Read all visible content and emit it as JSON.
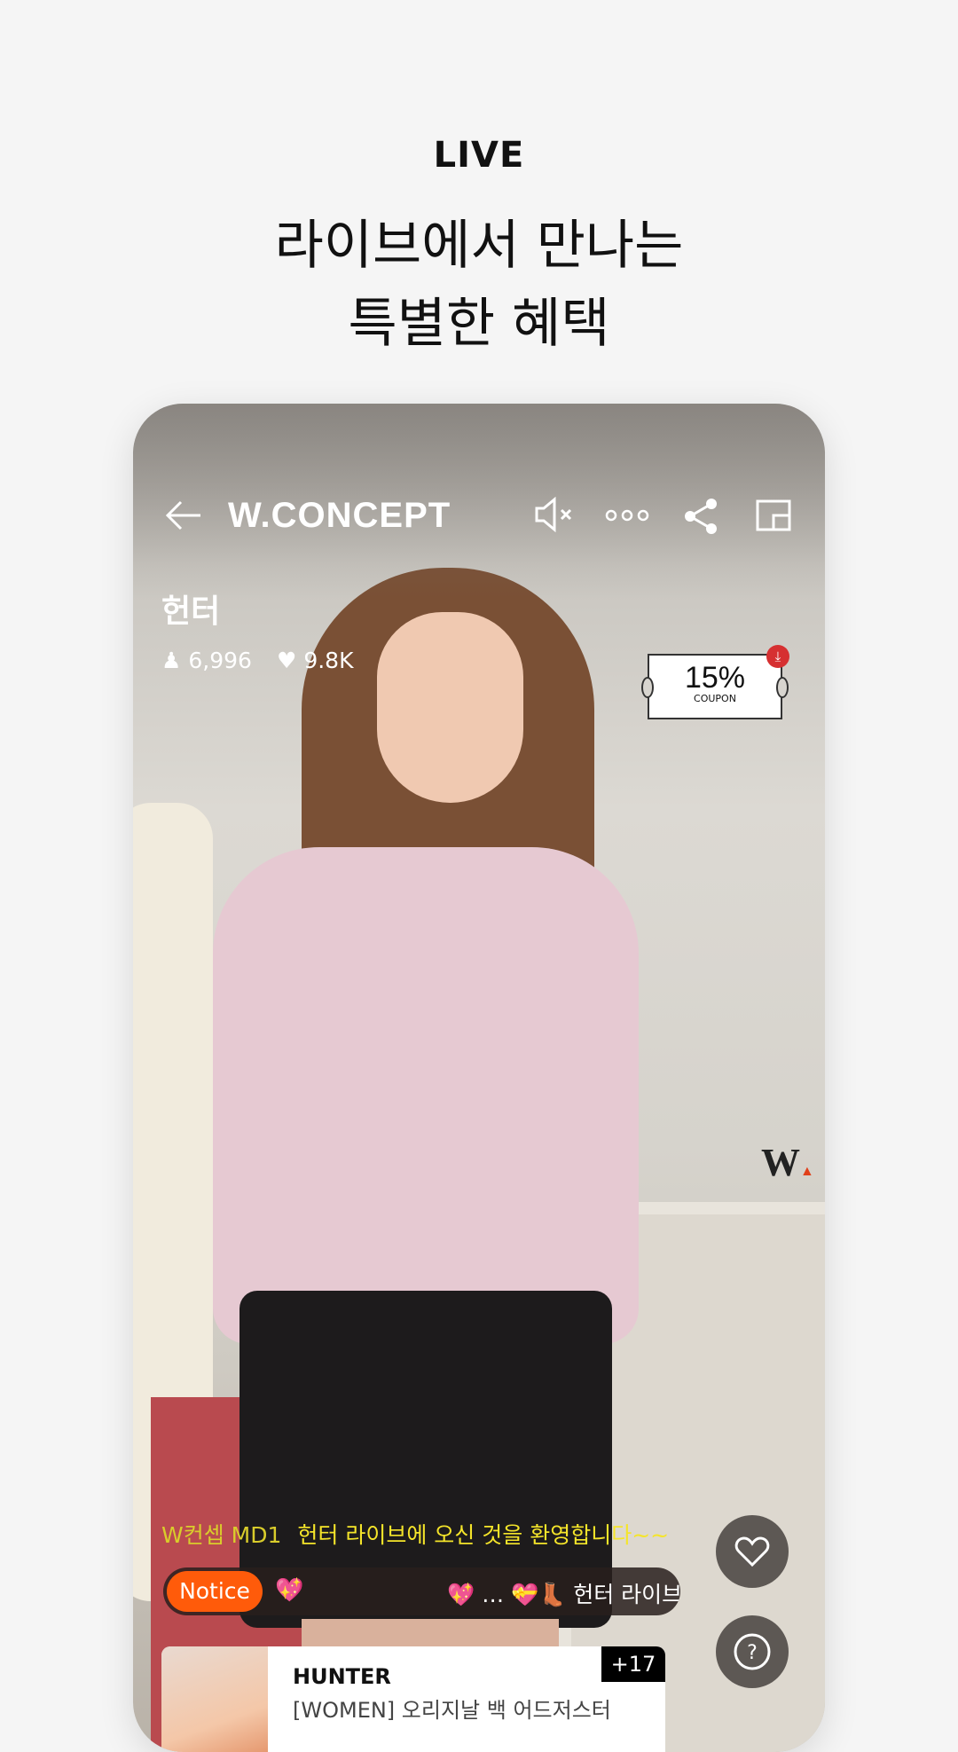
{
  "header": {
    "label": "LIVE",
    "line1": "라이브에서 만나는",
    "line2": "특별한 혜택"
  },
  "live": {
    "logo": "W.CONCEPT",
    "icons": [
      "back-arrow-icon",
      "mute-icon",
      "more-icon",
      "share-icon",
      "pip-icon"
    ],
    "host": "헌터",
    "viewers": "6,996",
    "likes": "9.8K",
    "coupon": {
      "percent": "15%",
      "label": "COUPON"
    },
    "chat": {
      "user": "W컨셉 MD1",
      "message": "헌터 라이브에 오신 것을 환영합니다~~"
    },
    "notice": {
      "label": "Notice",
      "text": "💖 … 💝👢 헌터 라이브 기획가"
    },
    "product": {
      "brand": "HUNTER",
      "name": "[WOMEN] 오리지날 백 어드저스터",
      "more": "+17"
    }
  },
  "colors": {
    "notice": "#ff5b0a",
    "chat": "#f5e52a",
    "background": "#f5f5f5"
  }
}
